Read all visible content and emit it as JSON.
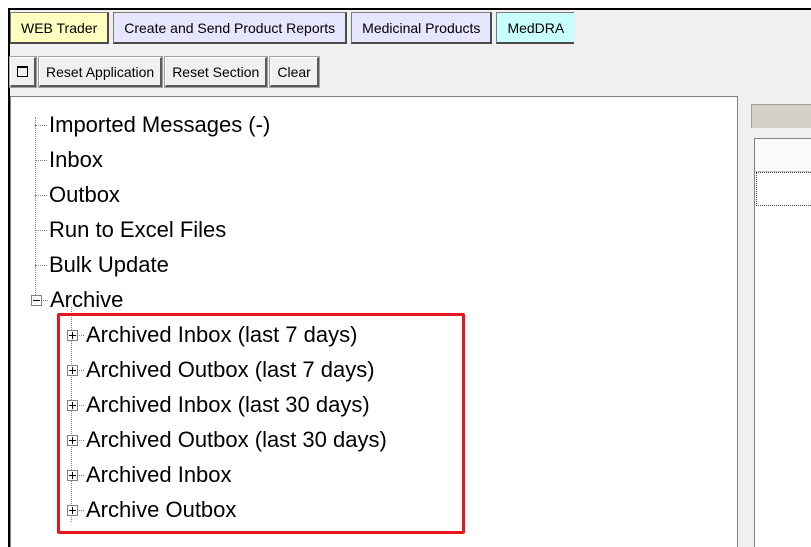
{
  "tabs": [
    {
      "label": "WEB Trader",
      "color": "#ffffc0"
    },
    {
      "label": "Create and Send Product Reports",
      "color": "#e6e6ff"
    },
    {
      "label": "Medicinal Products",
      "color": "#e6e6ff"
    },
    {
      "label": "MedDRA",
      "color": "#c8ffff"
    }
  ],
  "toolbar": {
    "square_icon": "window-square-icon",
    "reset_application": "Reset Application",
    "reset_section": "Reset Section",
    "clear": "Clear"
  },
  "tree": {
    "items": [
      {
        "label": "Imported Messages (-)"
      },
      {
        "label": "Inbox"
      },
      {
        "label": "Outbox"
      },
      {
        "label": "Run to Excel Files"
      },
      {
        "label": "Bulk Update"
      }
    ],
    "archive": {
      "label": "Archive",
      "expanded": true,
      "children": [
        {
          "label": "Archived Inbox (last 7 days)"
        },
        {
          "label": "Archived Outbox (last 7 days)"
        },
        {
          "label": "Archived Inbox (last 30 days)"
        },
        {
          "label": "Archived Outbox (last 30 days)"
        },
        {
          "label": "Archived Inbox"
        },
        {
          "label": "Archive Outbox"
        }
      ]
    }
  },
  "highlight_color": "#e8141e"
}
